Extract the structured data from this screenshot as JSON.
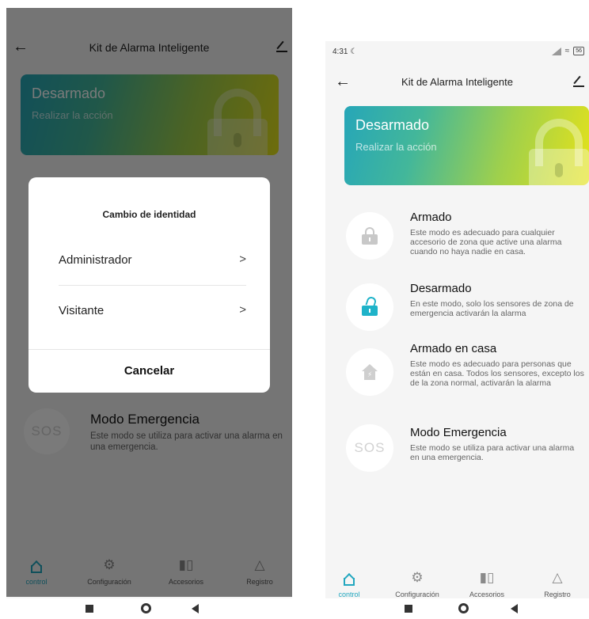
{
  "app": {
    "title": "Kit de Alarma Inteligente"
  },
  "status_bar": {
    "time": "4:31",
    "battery": "56"
  },
  "status_card": {
    "state": "Desarmado",
    "action": "Realizar la acción",
    "gradient": [
      "#26a6b8",
      "#9fd04c",
      "#e5e21a"
    ]
  },
  "modes": [
    {
      "name": "Armado",
      "icon": "padlock-closed-icon",
      "description": "Este modo es adecuado para cualquier accesorio de zona que active una alarma cuando no haya nadie en casa."
    },
    {
      "name": "Desarmado",
      "icon": "padlock-open-icon",
      "description": "En este modo, solo los sensores de zona de emergencia activarán la alarma"
    },
    {
      "name": "Armado en casa",
      "icon": "home-arm-icon",
      "description": "Este modo es adecuado para personas que están en casa. Todos los sensores, excepto los de la zona normal, activarán la alarma"
    },
    {
      "name": "Modo Emergencia",
      "icon": "sos-icon",
      "icon_text": "SOS",
      "description": "Este modo se utiliza para activar una alarma en una emergencia."
    }
  ],
  "bottom_nav": [
    {
      "label": "control",
      "icon": "home-icon",
      "active": true
    },
    {
      "label": "Configuración",
      "icon": "gear-icon",
      "active": false
    },
    {
      "label": "Accesorios",
      "icon": "sensor-icon",
      "active": false
    },
    {
      "label": "Registro",
      "icon": "warning-icon",
      "active": false
    }
  ],
  "dialog": {
    "title": "Cambio de identidad",
    "options": [
      {
        "label": "Administrador",
        "chevron": ">"
      },
      {
        "label": "Visitante",
        "chevron": ">"
      }
    ],
    "cancel": "Cancelar"
  },
  "colors": {
    "accent": "#22a7bf",
    "overlay": "rgba(0,0,0,0.52)"
  }
}
